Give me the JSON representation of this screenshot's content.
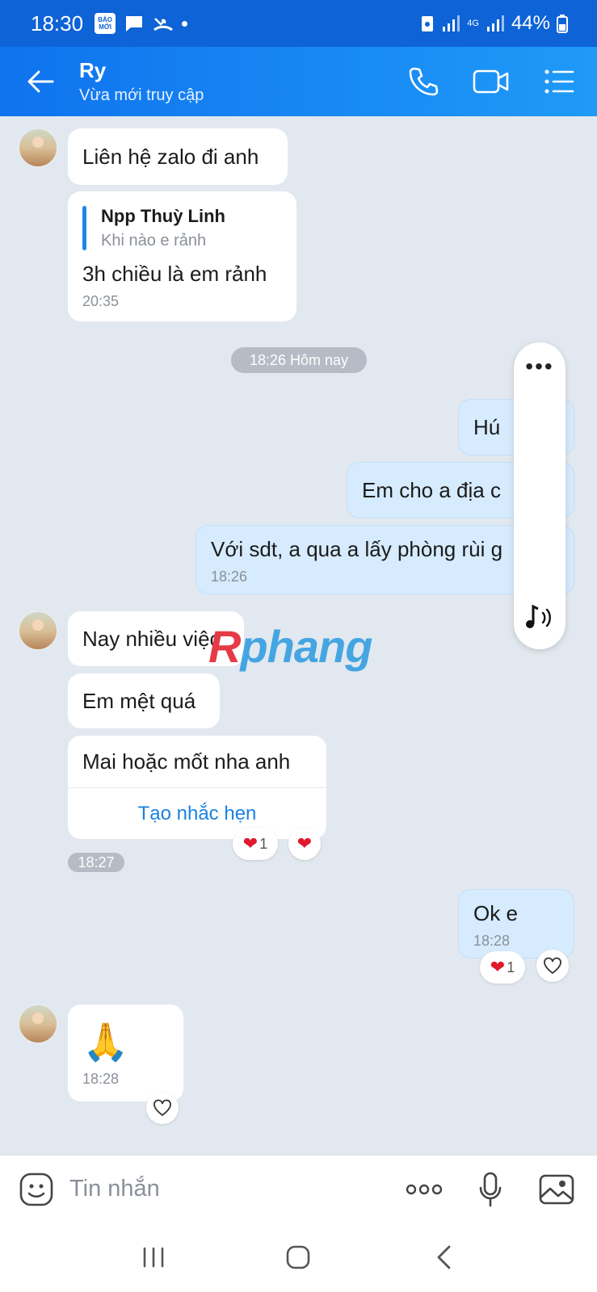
{
  "status_bar": {
    "time": "18:30",
    "app_badge": "BÁO MỚI",
    "network": "4G",
    "battery": "44%"
  },
  "header": {
    "contact_name": "Ry",
    "contact_status": "Vừa mới truy cập"
  },
  "messages": {
    "m1": {
      "text": "Liên hệ zalo đi anh"
    },
    "m2": {
      "quote_name": "Npp Thuỳ Linh",
      "quote_text": "Khi nào e rảnh",
      "text": "3h chiều là em rảnh",
      "time": "20:35"
    },
    "date_divider": "18:26 Hôm nay",
    "m3": {
      "text": "Hú"
    },
    "m4": {
      "text": "Em cho a địa c"
    },
    "m5": {
      "text": "Với sdt, a qua a lấy phòng rùi g",
      "time": "18:26"
    },
    "m6": {
      "text": "Nay nhiều việc"
    },
    "m7": {
      "text": "Em mệt quá"
    },
    "m8": {
      "text": "Mai hoặc mốt nha anh",
      "action": "Tạo nhắc hẹn",
      "reaction_count": "1"
    },
    "time_pill": "18:27",
    "m9": {
      "text": "Ok e",
      "time": "18:28",
      "reaction_count": "1"
    },
    "m10": {
      "emoji": "🙏",
      "time": "18:28"
    }
  },
  "float_panel": {
    "more_label": "•••"
  },
  "watermark": {
    "first": "R",
    "rest": "phang"
  },
  "input": {
    "placeholder": "Tin nhắn"
  },
  "colors": {
    "accent": "#0f73ee",
    "bubble_me": "#d6ebfd",
    "heart": "#e0192b",
    "link": "#1b82e0"
  }
}
